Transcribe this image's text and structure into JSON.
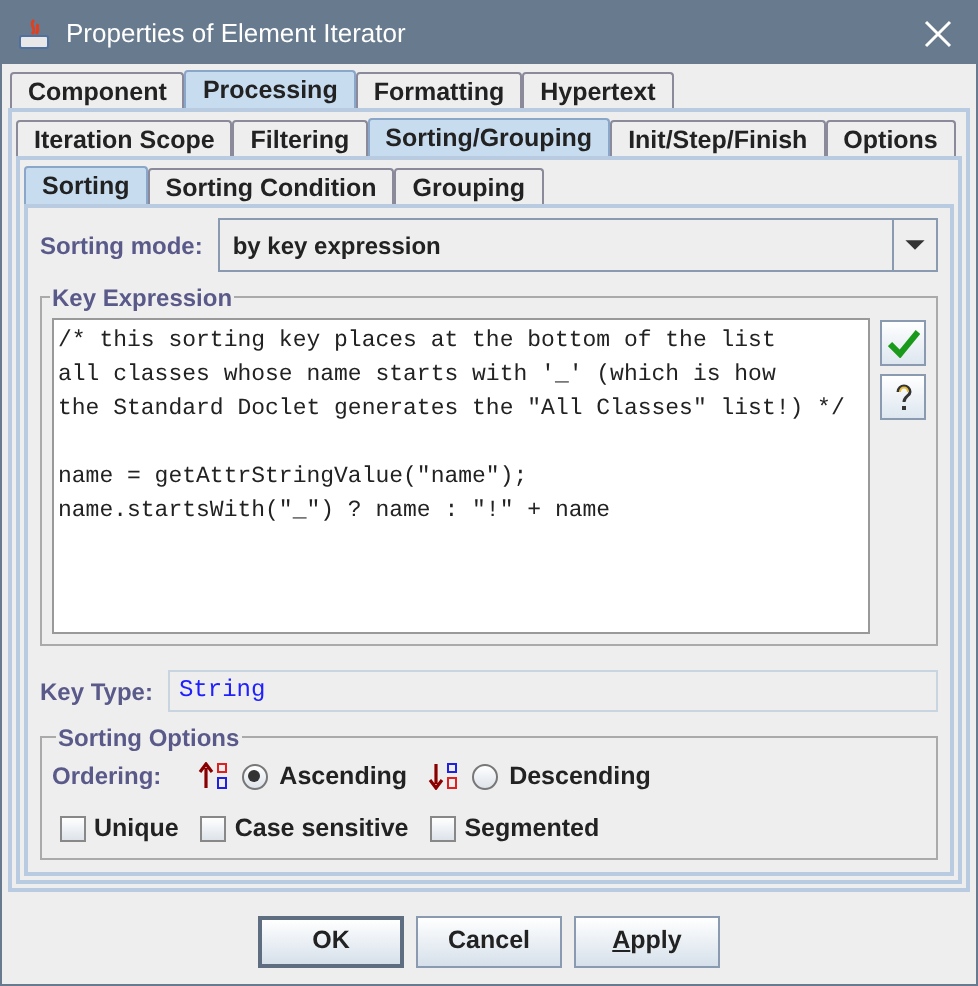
{
  "window": {
    "title": "Properties of Element Iterator"
  },
  "tabs": [
    {
      "label": "Component",
      "selected": false
    },
    {
      "label": "Processing",
      "selected": true
    },
    {
      "label": "Formatting",
      "selected": false
    },
    {
      "label": "Hypertext",
      "selected": false
    }
  ],
  "subtabs": [
    {
      "label": "Iteration Scope",
      "selected": false
    },
    {
      "label": "Filtering",
      "selected": false
    },
    {
      "label": "Sorting/Grouping",
      "selected": true
    },
    {
      "label": "Init/Step/Finish",
      "selected": false
    },
    {
      "label": "Options",
      "selected": false
    }
  ],
  "inner_tabs": [
    {
      "label": "Sorting",
      "selected": true
    },
    {
      "label": "Sorting Condition",
      "selected": false
    },
    {
      "label": "Grouping",
      "selected": false
    }
  ],
  "sorting_mode": {
    "label": "Sorting mode:",
    "value": "by key expression"
  },
  "key_expression": {
    "title": "Key Expression",
    "code": "/* this sorting key places at the bottom of the list\nall classes whose name starts with '_' (which is how\nthe Standard Doclet generates the \"All Classes\" list!) */\n\nname = getAttrStringValue(\"name\");\nname.startsWith(\"_\") ? name : \"!\" + name"
  },
  "key_type": {
    "label": "Key Type:",
    "value": "String"
  },
  "sorting_options": {
    "title": "Sorting Options",
    "ordering_label": "Ordering:",
    "orderings": [
      {
        "label": "Ascending",
        "kind": "ascending",
        "selected": true
      },
      {
        "label": "Descending",
        "kind": "descending",
        "selected": false
      }
    ],
    "checkboxes": [
      {
        "label": "Unique",
        "checked": false
      },
      {
        "label": "Case sensitive",
        "checked": false
      },
      {
        "label": "Segmented",
        "checked": false
      }
    ]
  },
  "buttons": [
    {
      "label": "OK",
      "default": true,
      "first_letter_underlined": false
    },
    {
      "label": "Cancel",
      "default": false,
      "first_letter_underlined": false
    },
    {
      "label": "Apply",
      "default": false,
      "first_letter_underlined": true
    }
  ]
}
